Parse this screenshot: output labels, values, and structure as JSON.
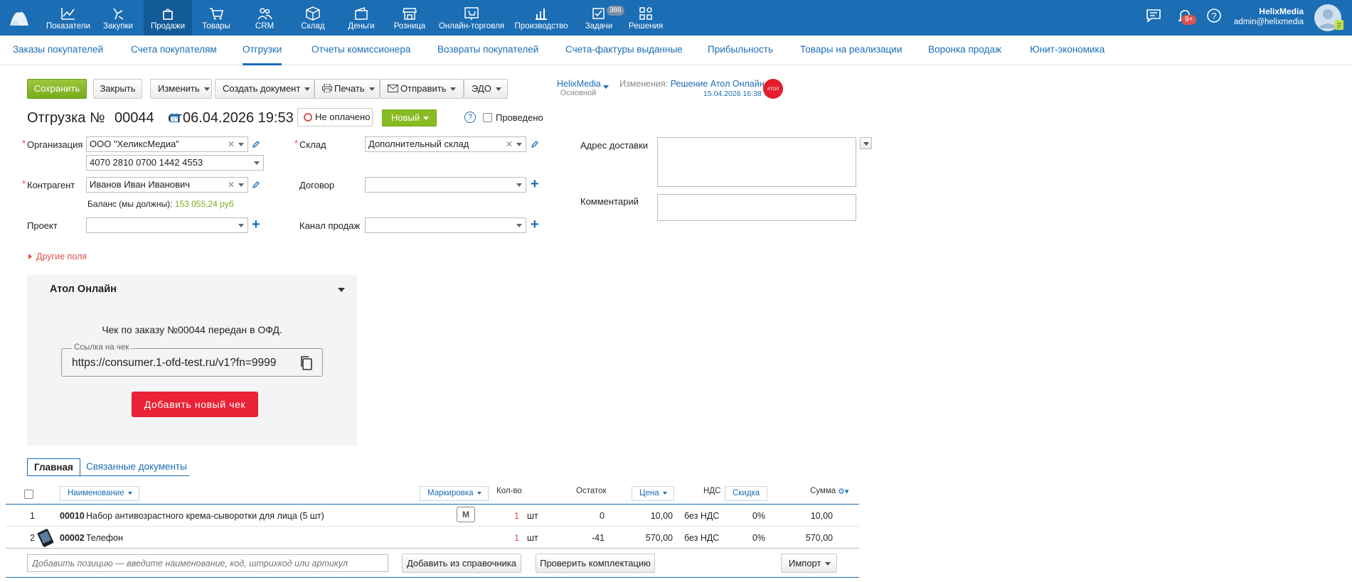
{
  "topnav": {
    "items": [
      {
        "label": "Показатели",
        "icon": "chart-line-icon"
      },
      {
        "label": "Закупки",
        "icon": "shopping-bag-icon"
      },
      {
        "label": "Продажи",
        "icon": "bag-icon"
      },
      {
        "label": "Товары",
        "icon": "cart-icon"
      },
      {
        "label": "CRM",
        "icon": "people-icon"
      },
      {
        "label": "Склад",
        "icon": "box-icon"
      },
      {
        "label": "Деньги",
        "icon": "wallet-icon"
      },
      {
        "label": "Розница",
        "icon": "store-icon"
      },
      {
        "label": "Онлайн-торговля",
        "icon": "online-store-icon"
      },
      {
        "label": "Производство",
        "icon": "production-chart-icon"
      },
      {
        "label": "Задачи",
        "icon": "tasks-icon"
      },
      {
        "label": "Решения",
        "icon": "apps-icon"
      }
    ],
    "tasks_badge": "386",
    "notifications_badge": "9+",
    "user_name": "HelixMedia",
    "user_email": "admin@helixmedia"
  },
  "subtabs": [
    "Заказы покупателей",
    "Счета покупателям",
    "Отгрузки",
    "Отчеты комиссионера",
    "Возвраты покупателей",
    "Счета-фактуры выданные",
    "Прибыльность",
    "Товары на реализации",
    "Воронка продаж",
    "Юнит-экономика"
  ],
  "toolbar": {
    "save": "Сохранить",
    "close": "Закрыть",
    "edit": "Изменить",
    "create_doc": "Создать документ",
    "print": "Печать",
    "send": "Отправить",
    "edo": "ЭДО"
  },
  "account": {
    "name": "HelixMedia",
    "sub": "Основной"
  },
  "changes": {
    "label": "Изменения:",
    "source": "Решение Атол Онлайн",
    "date": "15.04.2026 16:38"
  },
  "header": {
    "title": "Отгрузка №",
    "number": "00044",
    "from": "от",
    "date": "06.04.2026 19:53",
    "payment_status": "Не оплачено",
    "status": "Новый",
    "conducted_label": "Проведено",
    "help": "?"
  },
  "form": {
    "org_label": "Организация",
    "org_value": "ООО \"ХеликсМедиа\"",
    "account_value": "4070 2810 0700 1442 4553",
    "contractor_label": "Контрагент",
    "contractor_value": "Иванов Иван Иванович",
    "balance_label": "Баланс (мы должны):",
    "balance_value": "153 055,24 руб",
    "project_label": "Проект",
    "warehouse_label": "Склад",
    "warehouse_value": "Дополнительный склад",
    "contract_label": "Договор",
    "channel_label": "Канал продаж",
    "delivery_label": "Адрес доставки",
    "comment_label": "Комментарий",
    "other_fields": "Другие поля"
  },
  "atol": {
    "title": "Атол Онлайн",
    "message": "Чек по заказу №00044 передан в ОФД.",
    "link_label": "Ссылка на чек",
    "link_value": "https://consumer.1-ofd-test.ru/v1?fn=9999",
    "add_button": "Добавить новый чек"
  },
  "bottom_tabs": [
    "Главная",
    "Связанные документы"
  ],
  "table": {
    "headers": {
      "name": "Наименование",
      "marking": "Маркировка",
      "qty": "Кол-во",
      "rest": "Остаток",
      "price": "Цена",
      "vat": "НДС",
      "discount": "Скидка",
      "sum": "Сумма"
    },
    "rows": [
      {
        "n": "1",
        "code": "00010",
        "name": "Набор антивозрастного крема-сыворотки для лица (5 шт)",
        "mark": "М",
        "qty": "1",
        "unit": "шт",
        "rest": "0",
        "price": "10,00",
        "vat": "без НДС",
        "discount": "0%",
        "sum": "10,00"
      },
      {
        "n": "2",
        "code": "00002",
        "name": "Телефон",
        "mark": "",
        "qty": "1",
        "unit": "шт",
        "rest": "-41",
        "price": "570,00",
        "vat": "без НДС",
        "discount": "0%",
        "sum": "570,00"
      }
    ],
    "add_placeholder": "Добавить позицию — введите наименование, код, штрихкод или артикул",
    "add_from_catalog": "Добавить из справочника",
    "check_set": "Проверить комплектацию",
    "import": "Импорт"
  }
}
